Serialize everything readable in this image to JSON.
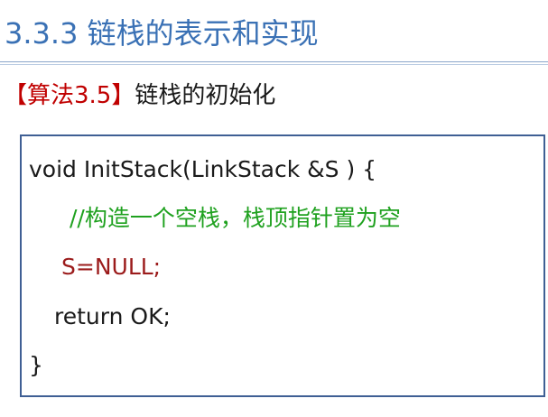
{
  "slide": {
    "title": "3.3.3 链栈的表示和实现",
    "algorithm_tag": "【算法3.5】",
    "algorithm_title": "链栈的初始化"
  },
  "code": {
    "lines": [
      "void InitStack(LinkStack &S ) {",
      "//构造一个空栈，栈顶指针置为空",
      "S=NULL;",
      "return OK;",
      "}"
    ]
  },
  "colors": {
    "title": "#3a71b5",
    "algorithm_tag": "#c00000",
    "comment": "#1fa11f",
    "statement": "#9b1b1b",
    "code_border": "#3f5f94"
  }
}
